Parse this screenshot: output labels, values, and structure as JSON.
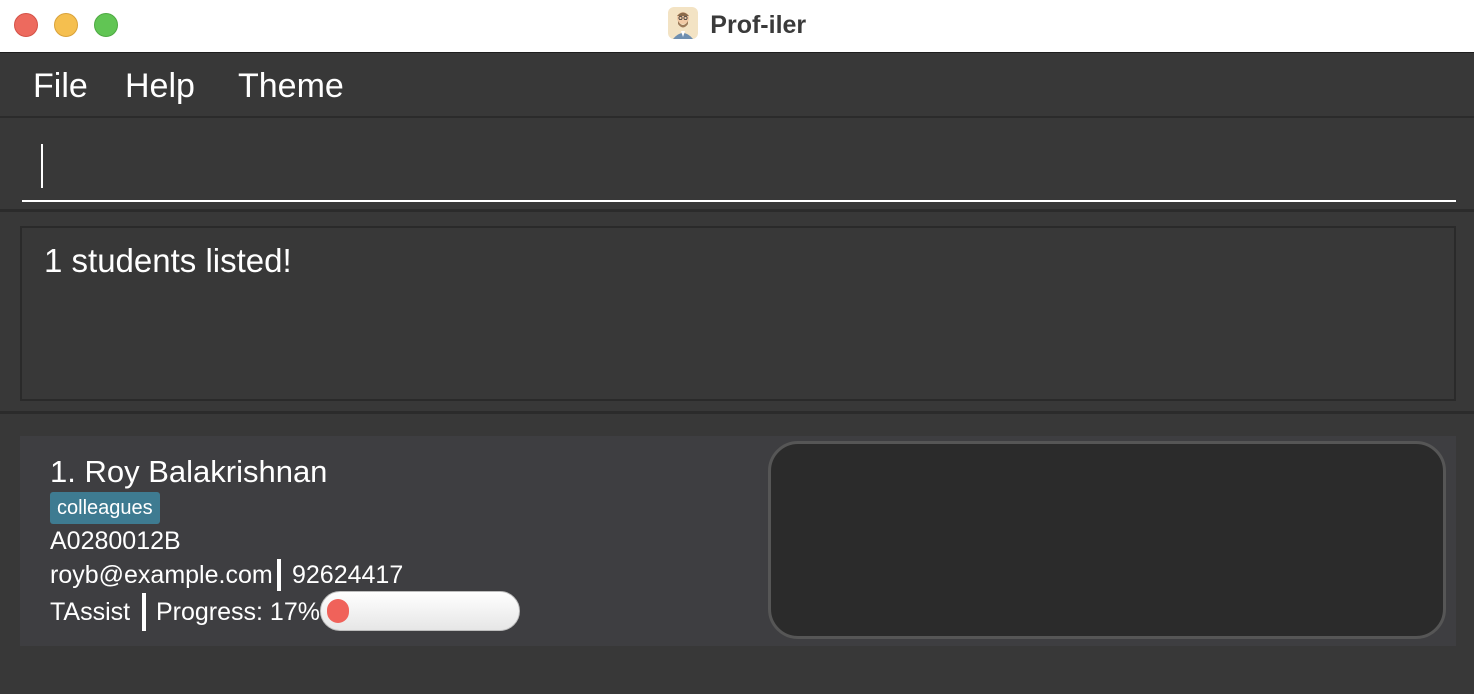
{
  "window": {
    "title": "Prof-iler",
    "app_icon": "professor-avatar-icon"
  },
  "colors": {
    "background": "#383838",
    "card": "#3e3e41",
    "tag": "#3e7b91",
    "progress_fill": "#f0625a",
    "detail_panel": "#2b2b2b"
  },
  "menu": {
    "items": [
      "File",
      "Help",
      "Theme"
    ]
  },
  "command_box": {
    "value": "",
    "placeholder": ""
  },
  "result_display": {
    "text": "1 students listed!"
  },
  "students": [
    {
      "name": "1. Roy Balakrishnan",
      "tags": [
        "colleagues"
      ],
      "id": "A0280012B",
      "email": "royb@example.com",
      "phone": "92624417",
      "github": "TAssist",
      "progress_label": "Progress: 17%",
      "progress_fraction": 0.17
    }
  ]
}
